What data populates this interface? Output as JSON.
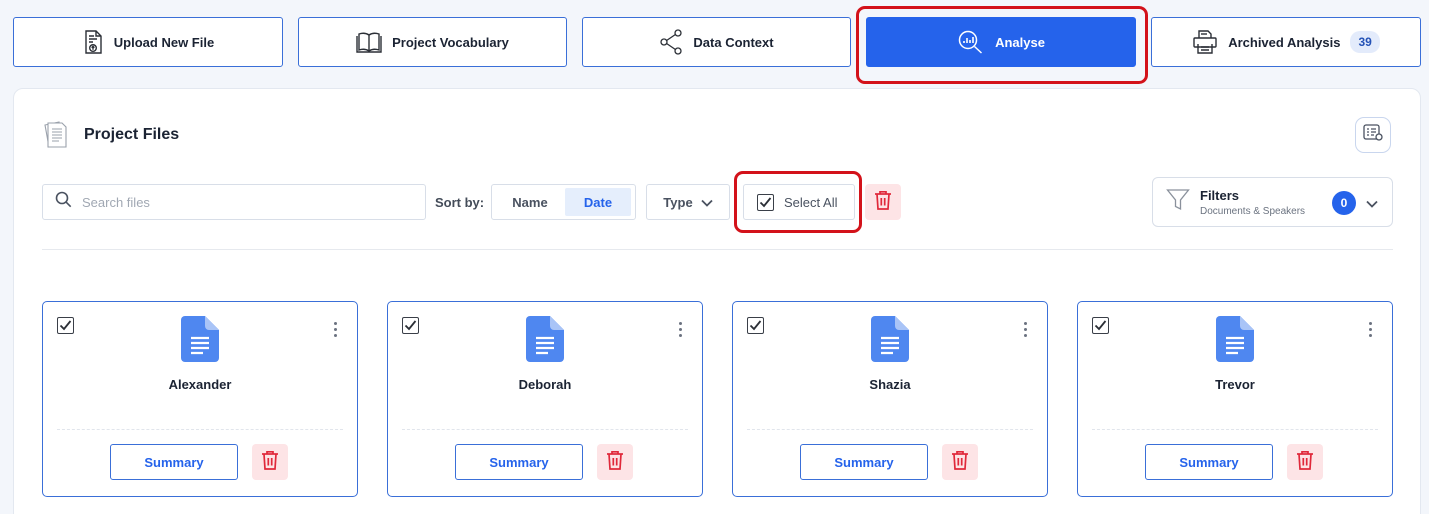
{
  "nav": {
    "upload_label": "Upload New File",
    "vocabulary_label": "Project Vocabulary",
    "data_context_label": "Data Context",
    "analyse_label": "Analyse",
    "archived_label": "Archived Analysis",
    "archived_count": "39"
  },
  "panel": {
    "title": "Project Files",
    "search_placeholder": "Search files",
    "sort_label": "Sort by:",
    "sort_options": [
      "Name",
      "Date"
    ],
    "sort_selected": "Date",
    "type_label": "Type",
    "select_all_label": "Select All",
    "filters_title": "Filters",
    "filters_subtitle": "Documents & Speakers",
    "filters_count": "0"
  },
  "files": [
    {
      "name": "Alexander",
      "checked": true,
      "summary_label": "Summary"
    },
    {
      "name": "Deborah",
      "checked": true,
      "summary_label": "Summary"
    },
    {
      "name": "Shazia",
      "checked": true,
      "summary_label": "Summary"
    },
    {
      "name": "Trevor",
      "checked": true,
      "summary_label": "Summary"
    }
  ],
  "colors": {
    "accent": "#2563eb",
    "highlight": "#d3121a",
    "delete_bg": "#fde4e6",
    "delete_icon": "#e0283a"
  },
  "icons": {
    "upload": "file-upload-icon",
    "vocabulary": "book-icon",
    "data_context": "share-icon",
    "analyse": "analyse-search-icon",
    "archived": "printer-archive-icon",
    "file": "document-icon",
    "delete": "trash-icon",
    "filter": "funnel-icon"
  }
}
